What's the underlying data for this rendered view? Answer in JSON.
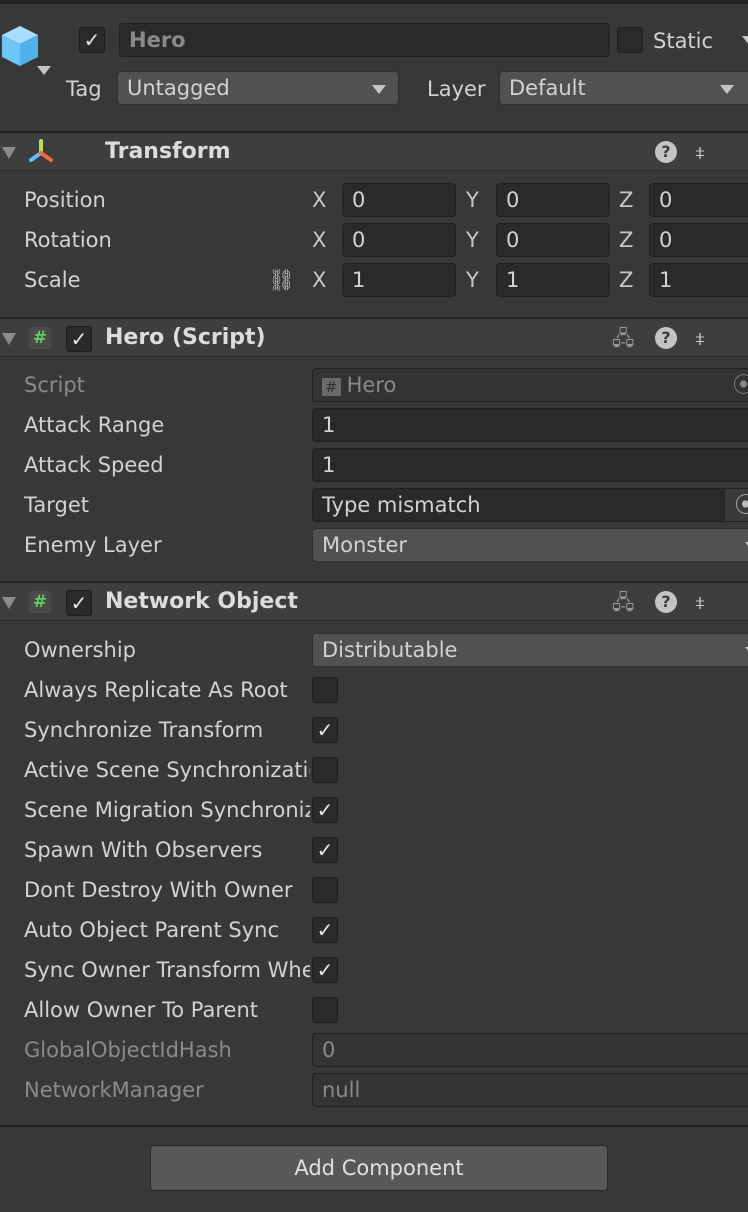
{
  "gameobject": {
    "active": true,
    "name": "Hero",
    "static_label": "Static",
    "static": false,
    "tag_label": "Tag",
    "tag": "Untagged",
    "layer_label": "Layer",
    "layer": "Default"
  },
  "transform": {
    "title": "Transform",
    "rows": [
      {
        "label": "Position",
        "x": "0",
        "y": "0",
        "z": "0"
      },
      {
        "label": "Rotation",
        "x": "0",
        "y": "0",
        "z": "0"
      },
      {
        "label": "Scale",
        "x": "1",
        "y": "1",
        "z": "1"
      }
    ],
    "axes": {
      "x": "X",
      "y": "Y",
      "z": "Z"
    }
  },
  "hero_script": {
    "title": "Hero (Script)",
    "enabled": true,
    "script_label": "Script",
    "script_value": "Hero",
    "attack_range_label": "Attack Range",
    "attack_range": "1",
    "attack_speed_label": "Attack Speed",
    "attack_speed": "1",
    "target_label": "Target",
    "target": "Type mismatch",
    "enemy_layer_label": "Enemy Layer",
    "enemy_layer": "Monster"
  },
  "network_object": {
    "title": "Network Object",
    "enabled": true,
    "ownership_label": "Ownership",
    "ownership": "Distributable",
    "toggles": [
      {
        "label": "Always Replicate As Root",
        "checked": false
      },
      {
        "label": "Synchronize Transform",
        "checked": true
      },
      {
        "label": "Active Scene Synchronization",
        "checked": false
      },
      {
        "label": "Scene Migration Synchronization",
        "checked": true
      },
      {
        "label": "Spawn With Observers",
        "checked": true
      },
      {
        "label": "Dont Destroy With Owner",
        "checked": false
      },
      {
        "label": "Auto Object Parent Sync",
        "checked": true
      },
      {
        "label": "Sync Owner Transform When Parented",
        "checked": true
      },
      {
        "label": "Allow Owner To Parent",
        "checked": false
      }
    ],
    "hash_label": "GlobalObjectIdHash",
    "hash": "0",
    "manager_label": "NetworkManager",
    "manager": "null"
  },
  "add_component": "Add Component"
}
